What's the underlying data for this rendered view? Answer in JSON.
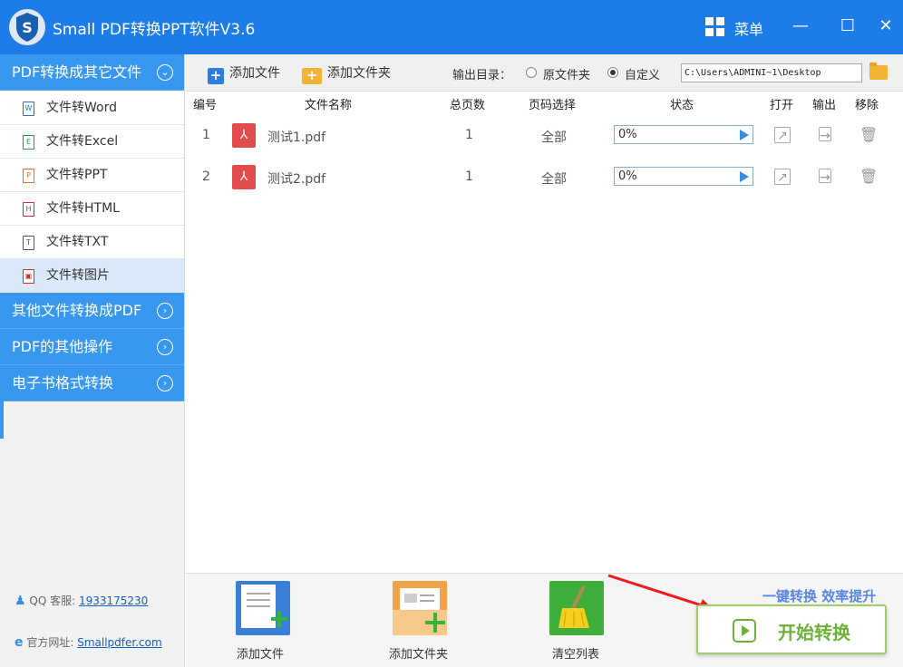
{
  "titlebar": {
    "title": "Small PDF转换PPT软件V3.6",
    "menu": "菜单",
    "minimize": "—",
    "maximize": "☐",
    "close": "✕",
    "logo_letter": "S"
  },
  "sidebar": {
    "group1": "PDF转换成其它文件",
    "items": [
      {
        "label": "文件转Word",
        "icon": "W",
        "color": "#2a6fc9"
      },
      {
        "label": "文件转Excel",
        "icon": "E",
        "color": "#2a9a46"
      },
      {
        "label": "文件转PPT",
        "icon": "P",
        "color": "#d9782a"
      },
      {
        "label": "文件转HTML",
        "icon": "H",
        "color": "#c9302c"
      },
      {
        "label": "文件转TXT",
        "icon": "T",
        "color": "#555555"
      },
      {
        "label": "文件转图片",
        "icon": "▣",
        "color": "#c9302c"
      }
    ],
    "group2": "其他文件转换成PDF",
    "group3": "PDF的其他操作",
    "group4": "电子书格式转换",
    "qq_label": "QQ 客服:",
    "qq_number": "1933175230",
    "web_label": "官方网址:",
    "web_url": "Smallpdfer.com"
  },
  "toolbar": {
    "add_file": "添加文件",
    "add_folder": "添加文件夹",
    "output_label": "输出目录：",
    "opt_original": "原文件夹",
    "opt_custom": "自定义",
    "path": "C:\\Users\\ADMINI~1\\Desktop"
  },
  "table": {
    "headers": {
      "no": "编号",
      "name": "文件名称",
      "pages": "总页数",
      "range": "页码选择",
      "status": "状态",
      "open": "打开",
      "output": "输出",
      "remove": "移除"
    },
    "rows": [
      {
        "no": "1",
        "name": "测试1.pdf",
        "pages": "1",
        "range": "全部",
        "progress": "0%"
      },
      {
        "no": "2",
        "name": "测试2.pdf",
        "pages": "1",
        "range": "全部",
        "progress": "0%"
      }
    ]
  },
  "bottom": {
    "add_file": "添加文件",
    "add_folder": "添加文件夹",
    "clear": "清空列表",
    "slogan": "一键转换  效率提升",
    "start": "开始转换"
  }
}
